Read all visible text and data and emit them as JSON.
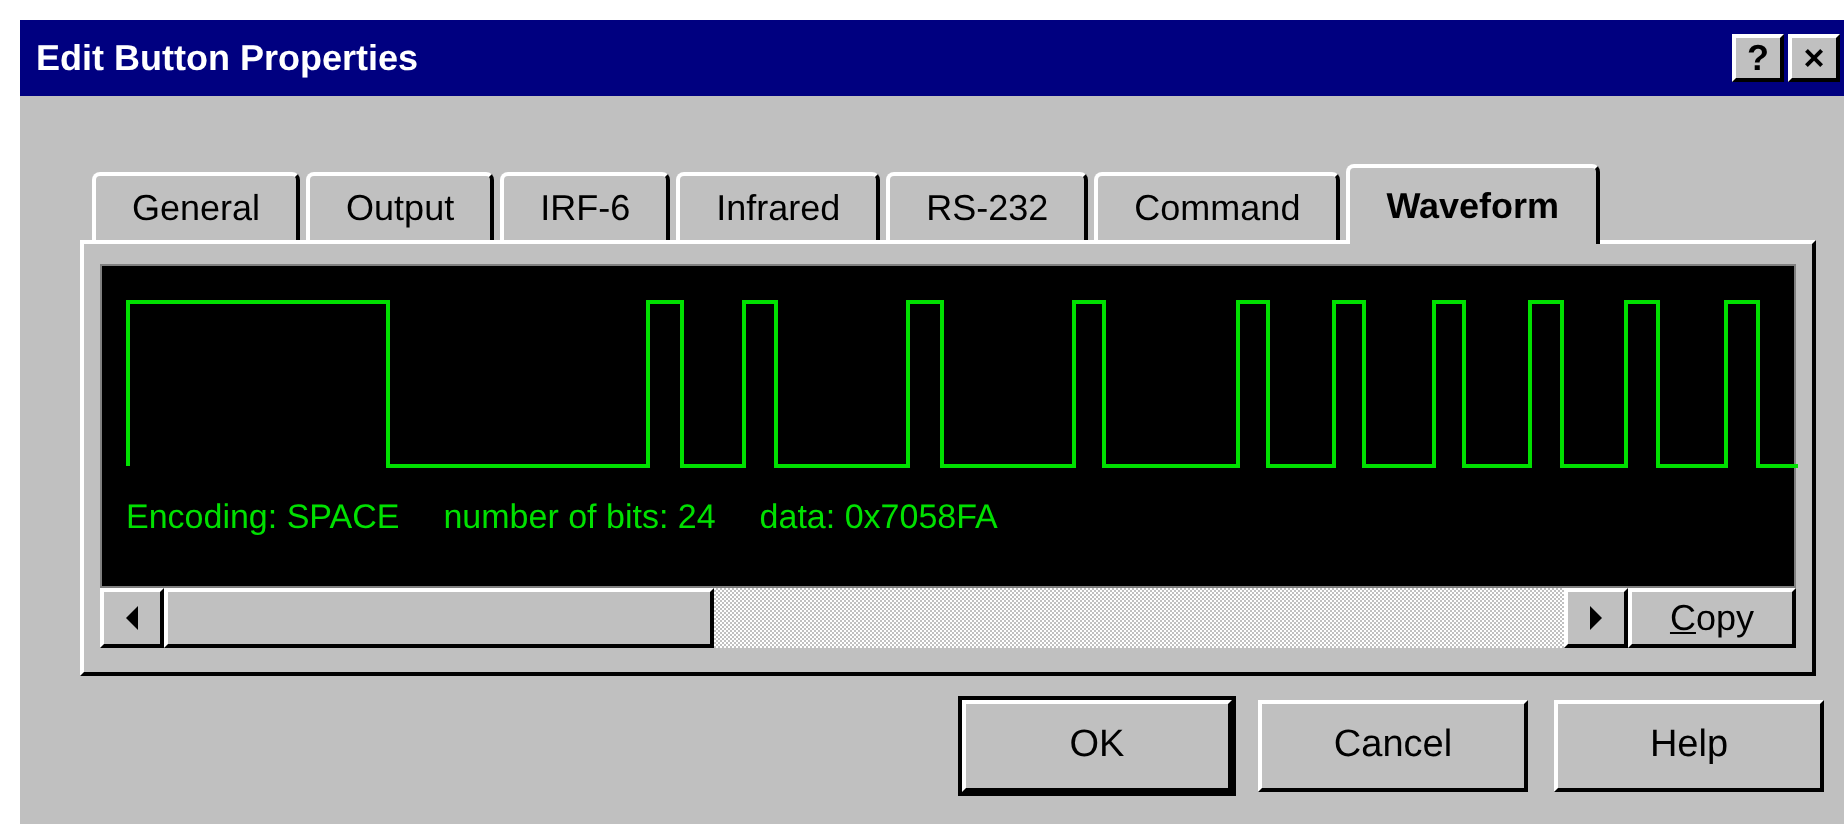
{
  "window": {
    "title": "Edit Button Properties",
    "title_buttons": [
      "?",
      "×"
    ]
  },
  "tabs": [
    {
      "label": "General",
      "selected": false
    },
    {
      "label": "Output",
      "selected": false
    },
    {
      "label": "IRF-6",
      "selected": false
    },
    {
      "label": "Infrared",
      "selected": false
    },
    {
      "label": "RS-232",
      "selected": false
    },
    {
      "label": "Command",
      "selected": false
    },
    {
      "label": "Waveform",
      "selected": true
    }
  ],
  "waveform": {
    "info": [
      "Encoding: SPACE",
      "number of bits: 24",
      "data: 0x7058FA"
    ],
    "copy_button": "Copy"
  },
  "buttons": [
    {
      "label": "OK",
      "default": true
    },
    {
      "label": "Cancel",
      "default": false
    },
    {
      "label": "Help",
      "default": false
    }
  ]
}
